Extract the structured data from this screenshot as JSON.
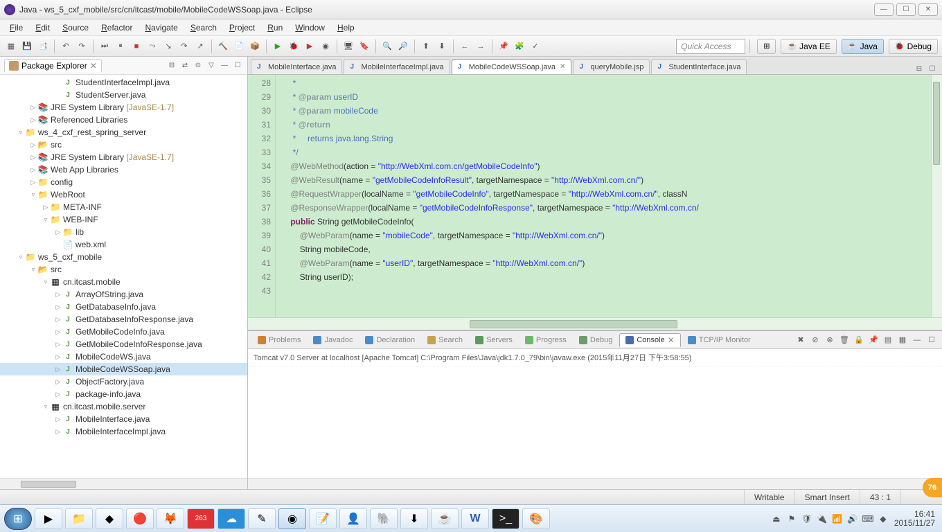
{
  "title": "Java - ws_5_cxf_mobile/src/cn/itcast/mobile/MobileCodeWSSoap.java - Eclipse",
  "menu": [
    "File",
    "Edit",
    "Source",
    "Refactor",
    "Navigate",
    "Search",
    "Project",
    "Run",
    "Window",
    "Help"
  ],
  "quick_access": "Quick Access",
  "perspectives": {
    "javaee": "Java EE",
    "java": "Java",
    "debug": "Debug"
  },
  "package_explorer": {
    "title": "Package Explorer"
  },
  "tree": [
    {
      "indent": 3,
      "twisty": "",
      "icon": "j",
      "label": "StudentInterfaceImpl.java"
    },
    {
      "indent": 3,
      "twisty": "",
      "icon": "j",
      "label": "StudentServer.java"
    },
    {
      "indent": 1,
      "twisty": "▷",
      "icon": "lib",
      "label": "JRE System Library",
      "extra": " [JavaSE-1.7]"
    },
    {
      "indent": 1,
      "twisty": "▷",
      "icon": "lib",
      "label": "Referenced Libraries"
    },
    {
      "indent": 0,
      "twisty": "▿",
      "icon": "proj",
      "label": "ws_4_cxf_rest_spring_server"
    },
    {
      "indent": 1,
      "twisty": "▷",
      "icon": "src",
      "label": "src"
    },
    {
      "indent": 1,
      "twisty": "▷",
      "icon": "lib",
      "label": "JRE System Library",
      "extra": " [JavaSE-1.7]"
    },
    {
      "indent": 1,
      "twisty": "▷",
      "icon": "lib",
      "label": "Web App Libraries"
    },
    {
      "indent": 1,
      "twisty": "▷",
      "icon": "fold",
      "label": "config"
    },
    {
      "indent": 1,
      "twisty": "▿",
      "icon": "fold",
      "label": "WebRoot"
    },
    {
      "indent": 2,
      "twisty": "▷",
      "icon": "fold",
      "label": "META-INF"
    },
    {
      "indent": 2,
      "twisty": "▿",
      "icon": "fold",
      "label": "WEB-INF"
    },
    {
      "indent": 3,
      "twisty": "▷",
      "icon": "fold",
      "label": "lib"
    },
    {
      "indent": 3,
      "twisty": "",
      "icon": "xml",
      "label": "web.xml"
    },
    {
      "indent": 0,
      "twisty": "▿",
      "icon": "proj",
      "label": "ws_5_cxf_mobile"
    },
    {
      "indent": 1,
      "twisty": "▿",
      "icon": "src",
      "label": "src"
    },
    {
      "indent": 2,
      "twisty": "▿",
      "icon": "pkg",
      "label": "cn.itcast.mobile"
    },
    {
      "indent": 3,
      "twisty": "▷",
      "icon": "j",
      "label": "ArrayOfString.java"
    },
    {
      "indent": 3,
      "twisty": "▷",
      "icon": "j",
      "label": "GetDatabaseInfo.java"
    },
    {
      "indent": 3,
      "twisty": "▷",
      "icon": "j",
      "label": "GetDatabaseInfoResponse.java"
    },
    {
      "indent": 3,
      "twisty": "▷",
      "icon": "j",
      "label": "GetMobileCodeInfo.java"
    },
    {
      "indent": 3,
      "twisty": "▷",
      "icon": "j",
      "label": "GetMobileCodeInfoResponse.java"
    },
    {
      "indent": 3,
      "twisty": "▷",
      "icon": "j",
      "label": "MobileCodeWS.java"
    },
    {
      "indent": 3,
      "twisty": "▷",
      "icon": "j",
      "label": "MobileCodeWSSoap.java",
      "selected": true
    },
    {
      "indent": 3,
      "twisty": "▷",
      "icon": "j",
      "label": "ObjectFactory.java"
    },
    {
      "indent": 3,
      "twisty": "▷",
      "icon": "j",
      "label": "package-info.java"
    },
    {
      "indent": 2,
      "twisty": "▿",
      "icon": "pkg",
      "label": "cn.itcast.mobile.server"
    },
    {
      "indent": 3,
      "twisty": "▷",
      "icon": "j",
      "label": "MobileInterface.java"
    },
    {
      "indent": 3,
      "twisty": "▷",
      "icon": "j",
      "label": "MobileInterfaceImpl.java"
    }
  ],
  "editor_tabs": [
    {
      "label": "MobileInterface.java",
      "active": false
    },
    {
      "label": "MobileInterfaceImpl.java",
      "active": false
    },
    {
      "label": "MobileCodeWSSoap.java",
      "active": true,
      "close": true
    },
    {
      "label": "queryMobile.jsp",
      "active": false
    },
    {
      "label": "StudentInterface.java",
      "active": false
    }
  ],
  "line_start": 28,
  "line_end": 43,
  "code_lines": [
    {
      "html": "     <span class='doc'>*</span>"
    },
    {
      "html": "     <span class='doc'>* <span class='doctag'>@param</span> userID</span>"
    },
    {
      "html": "     <span class='doc'>* <span class='doctag'>@param</span> mobileCode</span>"
    },
    {
      "html": "     <span class='doc'>* <span class='doctag'>@return</span></span>"
    },
    {
      "html": "     <span class='doc'>*     returns java.lang.String</span>"
    },
    {
      "html": "     <span class='doc'>*/</span>"
    },
    {
      "html": "    <span class='ann'>@WebMethod</span>(action = <span class='str'>\"http://WebXml.com.cn/getMobileCodeInfo\"</span>)"
    },
    {
      "html": "    <span class='ann'>@WebResult</span>(name = <span class='str'>\"getMobileCodeInfoResult\"</span>, targetNamespace = <span class='str'>\"http://WebXml.com.cn/\"</span>)"
    },
    {
      "html": "    <span class='ann'>@RequestWrapper</span>(localName = <span class='str'>\"getMobileCodeInfo\"</span>, targetNamespace = <span class='str'>\"http://WebXml.com.cn/\"</span>, classN"
    },
    {
      "html": "    <span class='ann'>@ResponseWrapper</span>(localName = <span class='str'>\"getMobileCodeInfoResponse\"</span>, targetNamespace = <span class='str'>\"http://WebXml.com.cn/</span>"
    },
    {
      "html": "    <span class='kw'>public</span> String getMobileCodeInfo("
    },
    {
      "html": "        <span class='ann'>@WebParam</span>(name = <span class='str'>\"mobileCode\"</span>, targetNamespace = <span class='str'>\"http://WebXml.com.cn/\"</span>)"
    },
    {
      "html": "        String mobileCode,"
    },
    {
      "html": "        <span class='ann'>@WebParam</span>(name = <span class='str'>\"userID\"</span>, targetNamespace = <span class='str'>\"http://WebXml.com.cn/\"</span>)"
    },
    {
      "html": "        String userID);"
    },
    {
      "html": ""
    }
  ],
  "bottom_tabs": [
    {
      "label": "Problems",
      "icon": "#d08030"
    },
    {
      "label": "Javadoc",
      "icon": "#4a8cc7"
    },
    {
      "label": "Declaration",
      "icon": "#4a8cc7"
    },
    {
      "label": "Search",
      "icon": "#c7a24a"
    },
    {
      "label": "Servers",
      "icon": "#5a9c5a"
    },
    {
      "label": "Progress",
      "icon": "#6cb86c"
    },
    {
      "label": "Debug",
      "icon": "#6c9c6c"
    },
    {
      "label": "Console",
      "icon": "#4a6ca8",
      "active": true,
      "close": true
    },
    {
      "label": "TCP/IP Monitor",
      "icon": "#4a8cc7"
    }
  ],
  "console_head": "Tomcat v7.0 Server at localhost [Apache Tomcat] C:\\Program Files\\Java\\jdk1.7.0_79\\bin\\javaw.exe (2015年11月27日 下午3:58:55)",
  "status": {
    "writable": "Writable",
    "insert": "Smart Insert",
    "pos": "43 : 1"
  },
  "clock": {
    "time": "16:41",
    "date": "2015/11/27"
  },
  "badge": "76"
}
